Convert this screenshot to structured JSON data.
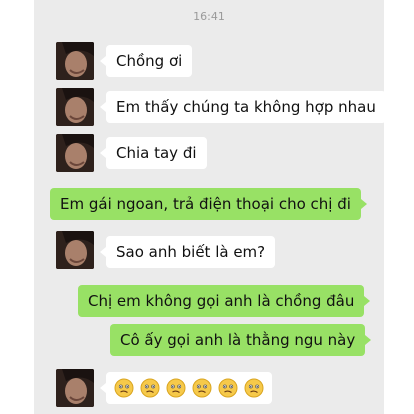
{
  "status": {
    "time": "16:41"
  },
  "messages": [
    {
      "side": "in",
      "text": "Chồng ơi"
    },
    {
      "side": "in",
      "text": "Em thấy chúng ta không hợp nhau"
    },
    {
      "side": "in",
      "text": "Chia tay đi"
    },
    {
      "side": "out",
      "text": "Em gái ngoan, trả điện thoại cho chị đi"
    },
    {
      "side": "in",
      "text": "Sao anh biết là em?"
    },
    {
      "side": "out",
      "text": "Chị em không gọi anh là chồng đâu"
    },
    {
      "side": "out",
      "text": "Cô ấy gọi anh là thằng ngu này"
    },
    {
      "side": "in",
      "emoji": "confused-face",
      "emoji_count": 6
    }
  ],
  "colors": {
    "incoming_bubble": "#ffffff",
    "outgoing_bubble": "#98e165",
    "chat_background": "#ebebeb"
  }
}
